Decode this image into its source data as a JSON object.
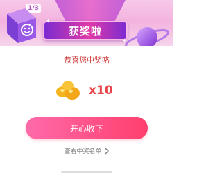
{
  "header": {
    "title": "获奖啦",
    "top_chip": "1/3",
    "cube_icon": "smiley-cube-icon",
    "planet_icon": "planet-icon"
  },
  "reward": {
    "congrats_text": "恭喜您中奖咯",
    "prize_icon": "gold-beans-icon",
    "count_text": "x10",
    "count": 10
  },
  "actions": {
    "accept_label": "开心收下",
    "view_winners_label": "查看中奖名单"
  },
  "colors": {
    "accent_pink": "#ff3f6e",
    "title_purple": "#7b2bd0",
    "congrats_red": "#d03b3b",
    "count_red": "#e8454a"
  }
}
